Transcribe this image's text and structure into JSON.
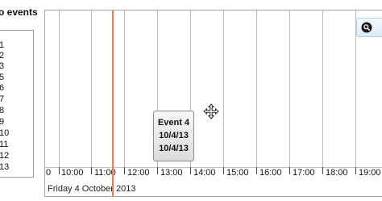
{
  "sidebar": {
    "title": "o events",
    "items": [
      "1",
      "2",
      "3",
      "5",
      "6",
      "7",
      "8",
      "9",
      "10",
      "11",
      "12",
      "13"
    ]
  },
  "timeline": {
    "hours": [
      "0",
      "10:00",
      "11:00",
      "12:00",
      "13:00",
      "14:00",
      "15:00",
      "16:00",
      "17:00",
      "18:00",
      "19:00"
    ],
    "date": "Friday 4 October 2013"
  },
  "event": {
    "title": "Event 4",
    "start": "10/4/13",
    "end": "10/4/13"
  },
  "colors": {
    "now_line": "#ee7b5a",
    "grid": "#bcbcbc",
    "zoom_accent": "#1a1a1a"
  },
  "icons": {
    "cursor": "move-cursor-icon",
    "zoom": "zoom-icon"
  }
}
